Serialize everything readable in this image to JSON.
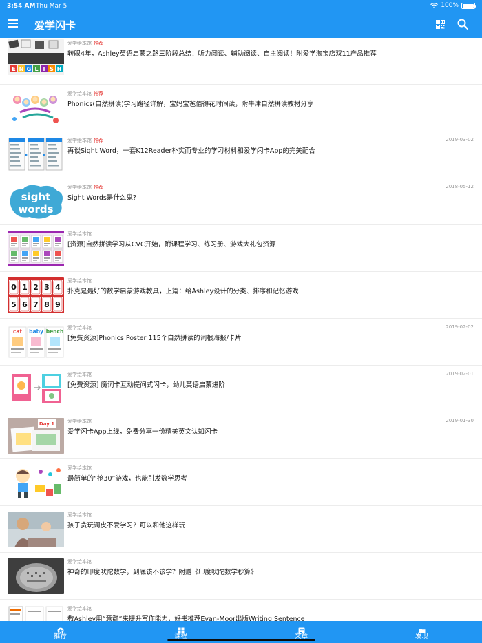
{
  "status_bar": {
    "time": "3:54 AM",
    "date": "Thu Mar 5",
    "battery": "100%",
    "wifi_icon": "wifi-icon",
    "battery_level": 1.0
  },
  "app_bar": {
    "title": "爱学闪卡",
    "menu_icon": "hamburger-menu-icon",
    "qr_icon": "qr-code-icon",
    "search_icon": "search-icon"
  },
  "colors": {
    "brand": "#2196f3",
    "tag": "#e53935",
    "meta": "#9a9a9a"
  },
  "articles": [
    {
      "source": "爱学绘本馆",
      "tag": "推荐",
      "date": "",
      "title": "转眼4年，Ashley英语启蒙之路三阶段总结：听力阅读、辅助阅读、自主阅读！附爱学淘宝店双11产品推荐",
      "thumb": "english-letter-blocks-image"
    },
    {
      "source": "爱学绘本馆",
      "tag": "推荐",
      "date": "",
      "title": "Phonics(自然拼读)学习路径详解，宝妈宝爸值得花时间读，附牛津自然拼读教材分享",
      "thumb": "phonics-cartoon-image"
    },
    {
      "source": "爱学绘本馆",
      "tag": "推荐",
      "date": "2019-03-02",
      "title": "再谈Sight Word，一套K12Reader朴实而专业的学习材料和爱学闪卡App的完美配合",
      "thumb": "app-screenshots-image"
    },
    {
      "source": "爱学绘本馆",
      "tag": "推荐",
      "date": "2018-05-12",
      "title": "Sight Words是什么鬼?",
      "thumb": "sight-words-image",
      "thumb_text": [
        "sight",
        "words"
      ]
    },
    {
      "source": "爱学绘本馆",
      "tag": "",
      "date": "",
      "title": "[资源]自然拼读学习从CVC开始，附课程学习、练习册、游戏大礼包资源",
      "thumb": "cvc-worksheets-image"
    },
    {
      "source": "爱学绘本馆",
      "tag": "",
      "date": "",
      "title": "扑克是最好的数学启蒙游戏教具，上篇：给Ashley设计的分类、排序和记忆游戏",
      "thumb": "number-cards-image",
      "thumb_numbers": [
        "0",
        "1",
        "2",
        "3",
        "4",
        "5",
        "6",
        "7",
        "8",
        "9"
      ]
    },
    {
      "source": "爱学绘本馆",
      "tag": "",
      "date": "2019-02-02",
      "title": "[免费资源]Phonics Poster 115个自然拼读的词根海报/卡片",
      "thumb": "phonics-poster-image",
      "thumb_words": [
        "cat",
        "baby",
        "bench"
      ]
    },
    {
      "source": "爱学绘本馆",
      "tag": "",
      "date": "2019-02-01",
      "title": "[免费资源] 魔词卡互动提问式闪卡，幼儿英语启蒙进阶",
      "thumb": "magic-word-cards-image"
    },
    {
      "source": "爱学绘本馆",
      "tag": "",
      "date": "2019-01-30",
      "title": "爱学闪卡App上线，免费分享一份精美英文认知闪卡",
      "thumb": "flashcards-photo-image",
      "thumb_text": [
        "Day 1"
      ]
    },
    {
      "source": "爱学绘本馆",
      "tag": "",
      "date": "",
      "title": "最简单的“抢30”游戏，也能引发数学思考",
      "thumb": "kid-cartoon-image"
    },
    {
      "source": "爱学绘本馆",
      "tag": "",
      "date": "",
      "title": "孩子贪玩调皮不爱学习？可以和他这样玩",
      "thumb": "family-photo-image"
    },
    {
      "source": "爱学绘本馆",
      "tag": "",
      "date": "",
      "title": "神奇的印度吠陀数学，到底该不该学？附赠《印度吠陀数学秒算》",
      "thumb": "stone-tablet-image"
    },
    {
      "source": "爱学绘本馆",
      "tag": "",
      "date": "",
      "title": "教Ashley用“意群”来提升写作能力，好书推荐Evan-Moor出版Writing Sentence",
      "thumb": "writing-book-image"
    }
  ],
  "tabs": [
    {
      "label": "推荐",
      "icon": "recommend-icon",
      "active": false
    },
    {
      "label": "课程",
      "icon": "course-grid-icon",
      "active": false
    },
    {
      "label": "文章",
      "icon": "article-icon",
      "active": true
    },
    {
      "label": "发现",
      "icon": "folder-icon",
      "active": false
    }
  ]
}
